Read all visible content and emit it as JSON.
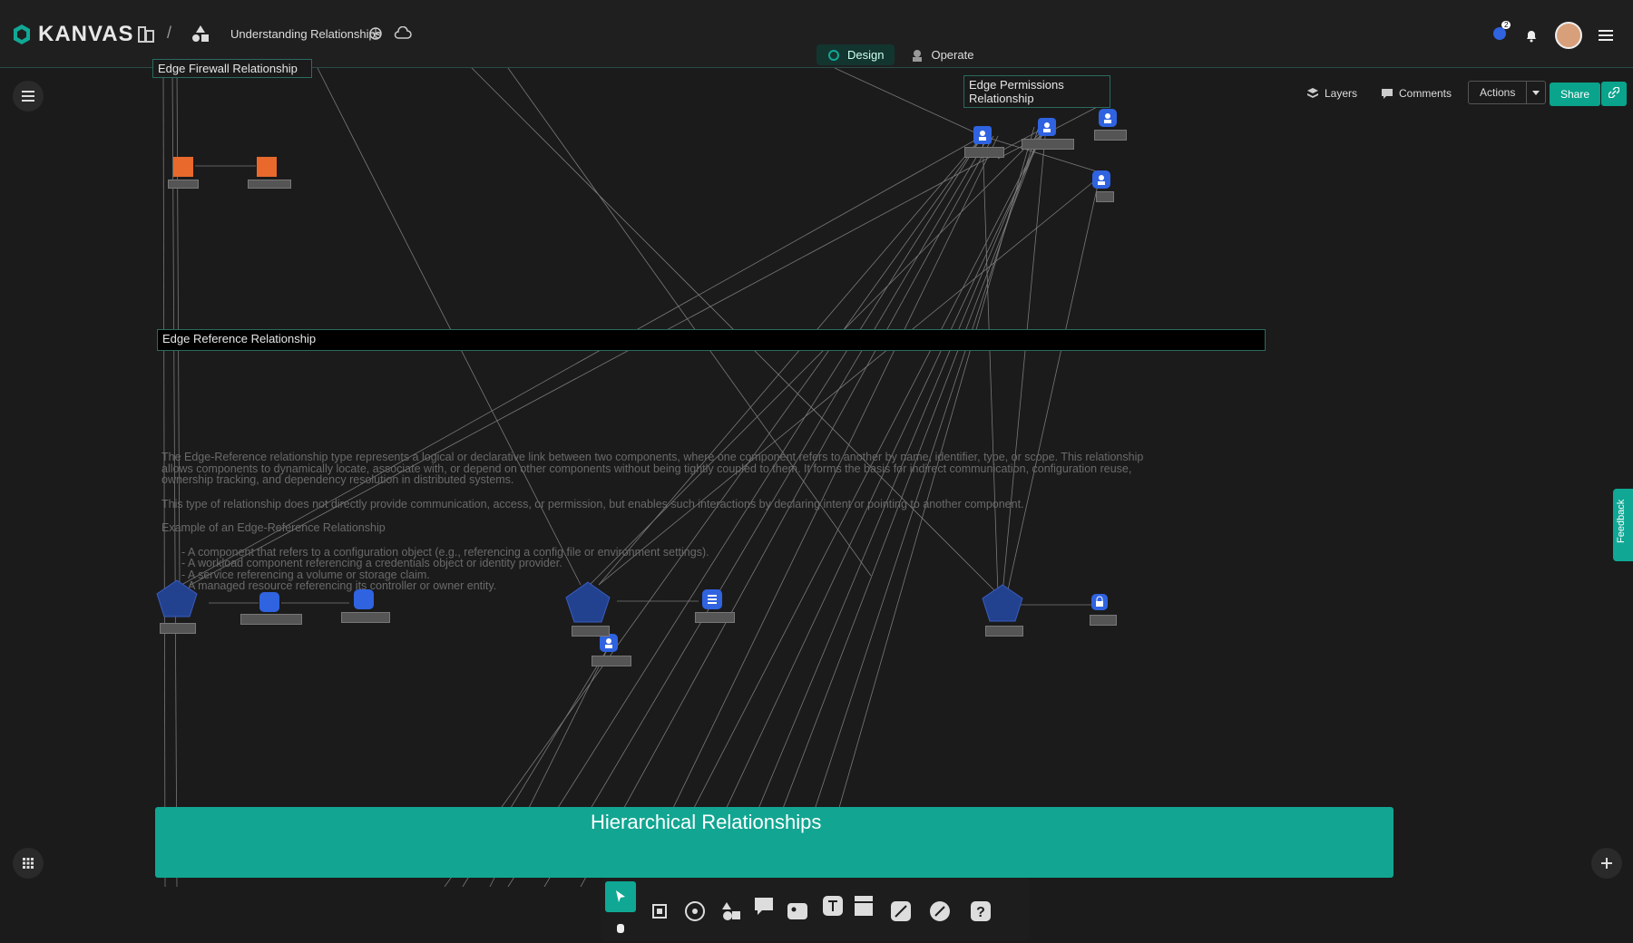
{
  "app": {
    "name": "KANVAS"
  },
  "header": {
    "design_title": "Understanding Relationships",
    "modes": [
      {
        "label": "Design",
        "active": true
      },
      {
        "label": "Operate",
        "active": false
      }
    ],
    "notification_count": "2"
  },
  "canvas_controls": {
    "layers": "Layers",
    "comments": "Comments",
    "actions": "Actions",
    "share": "Share"
  },
  "boxes": {
    "firewall": "Edge Firewall Relationship",
    "permissions": "Edge Permissions Relationship",
    "reference": "Edge Reference Relationship"
  },
  "description": {
    "p1": "The Edge-Reference relationship type represents a logical or declarative link between two components, where one component refers to another by name, identifier, type, or scope. This relationship allows components to dynamically locate, associate with, or depend on other components without being tightly coupled to them. It forms the basis for indirect communication, configuration reuse, ownership tracking, and dependency resolution in distributed systems.",
    "p2": "This type of relationship does not directly provide communication, access, or permission, but enables such interactions by declaring intent or pointing to another component.",
    "heading": "Example of an Edge-Reference Relationship",
    "items": [
      "A component that refers to a configuration object (e.g., referencing a config file or environment settings).",
      "A workload component referencing a credentials object or identity provider.",
      "A service referencing a volume or storage claim.",
      "A managed resource referencing its controller or owner entity."
    ]
  },
  "hierarchical": {
    "title": "Hierarchical Relationships"
  },
  "feedback": {
    "label": "Feedback"
  },
  "colors": {
    "accent": "#10a894",
    "orange": "#e8692b",
    "blue": "#2f63e0",
    "navy": "#22428f"
  }
}
